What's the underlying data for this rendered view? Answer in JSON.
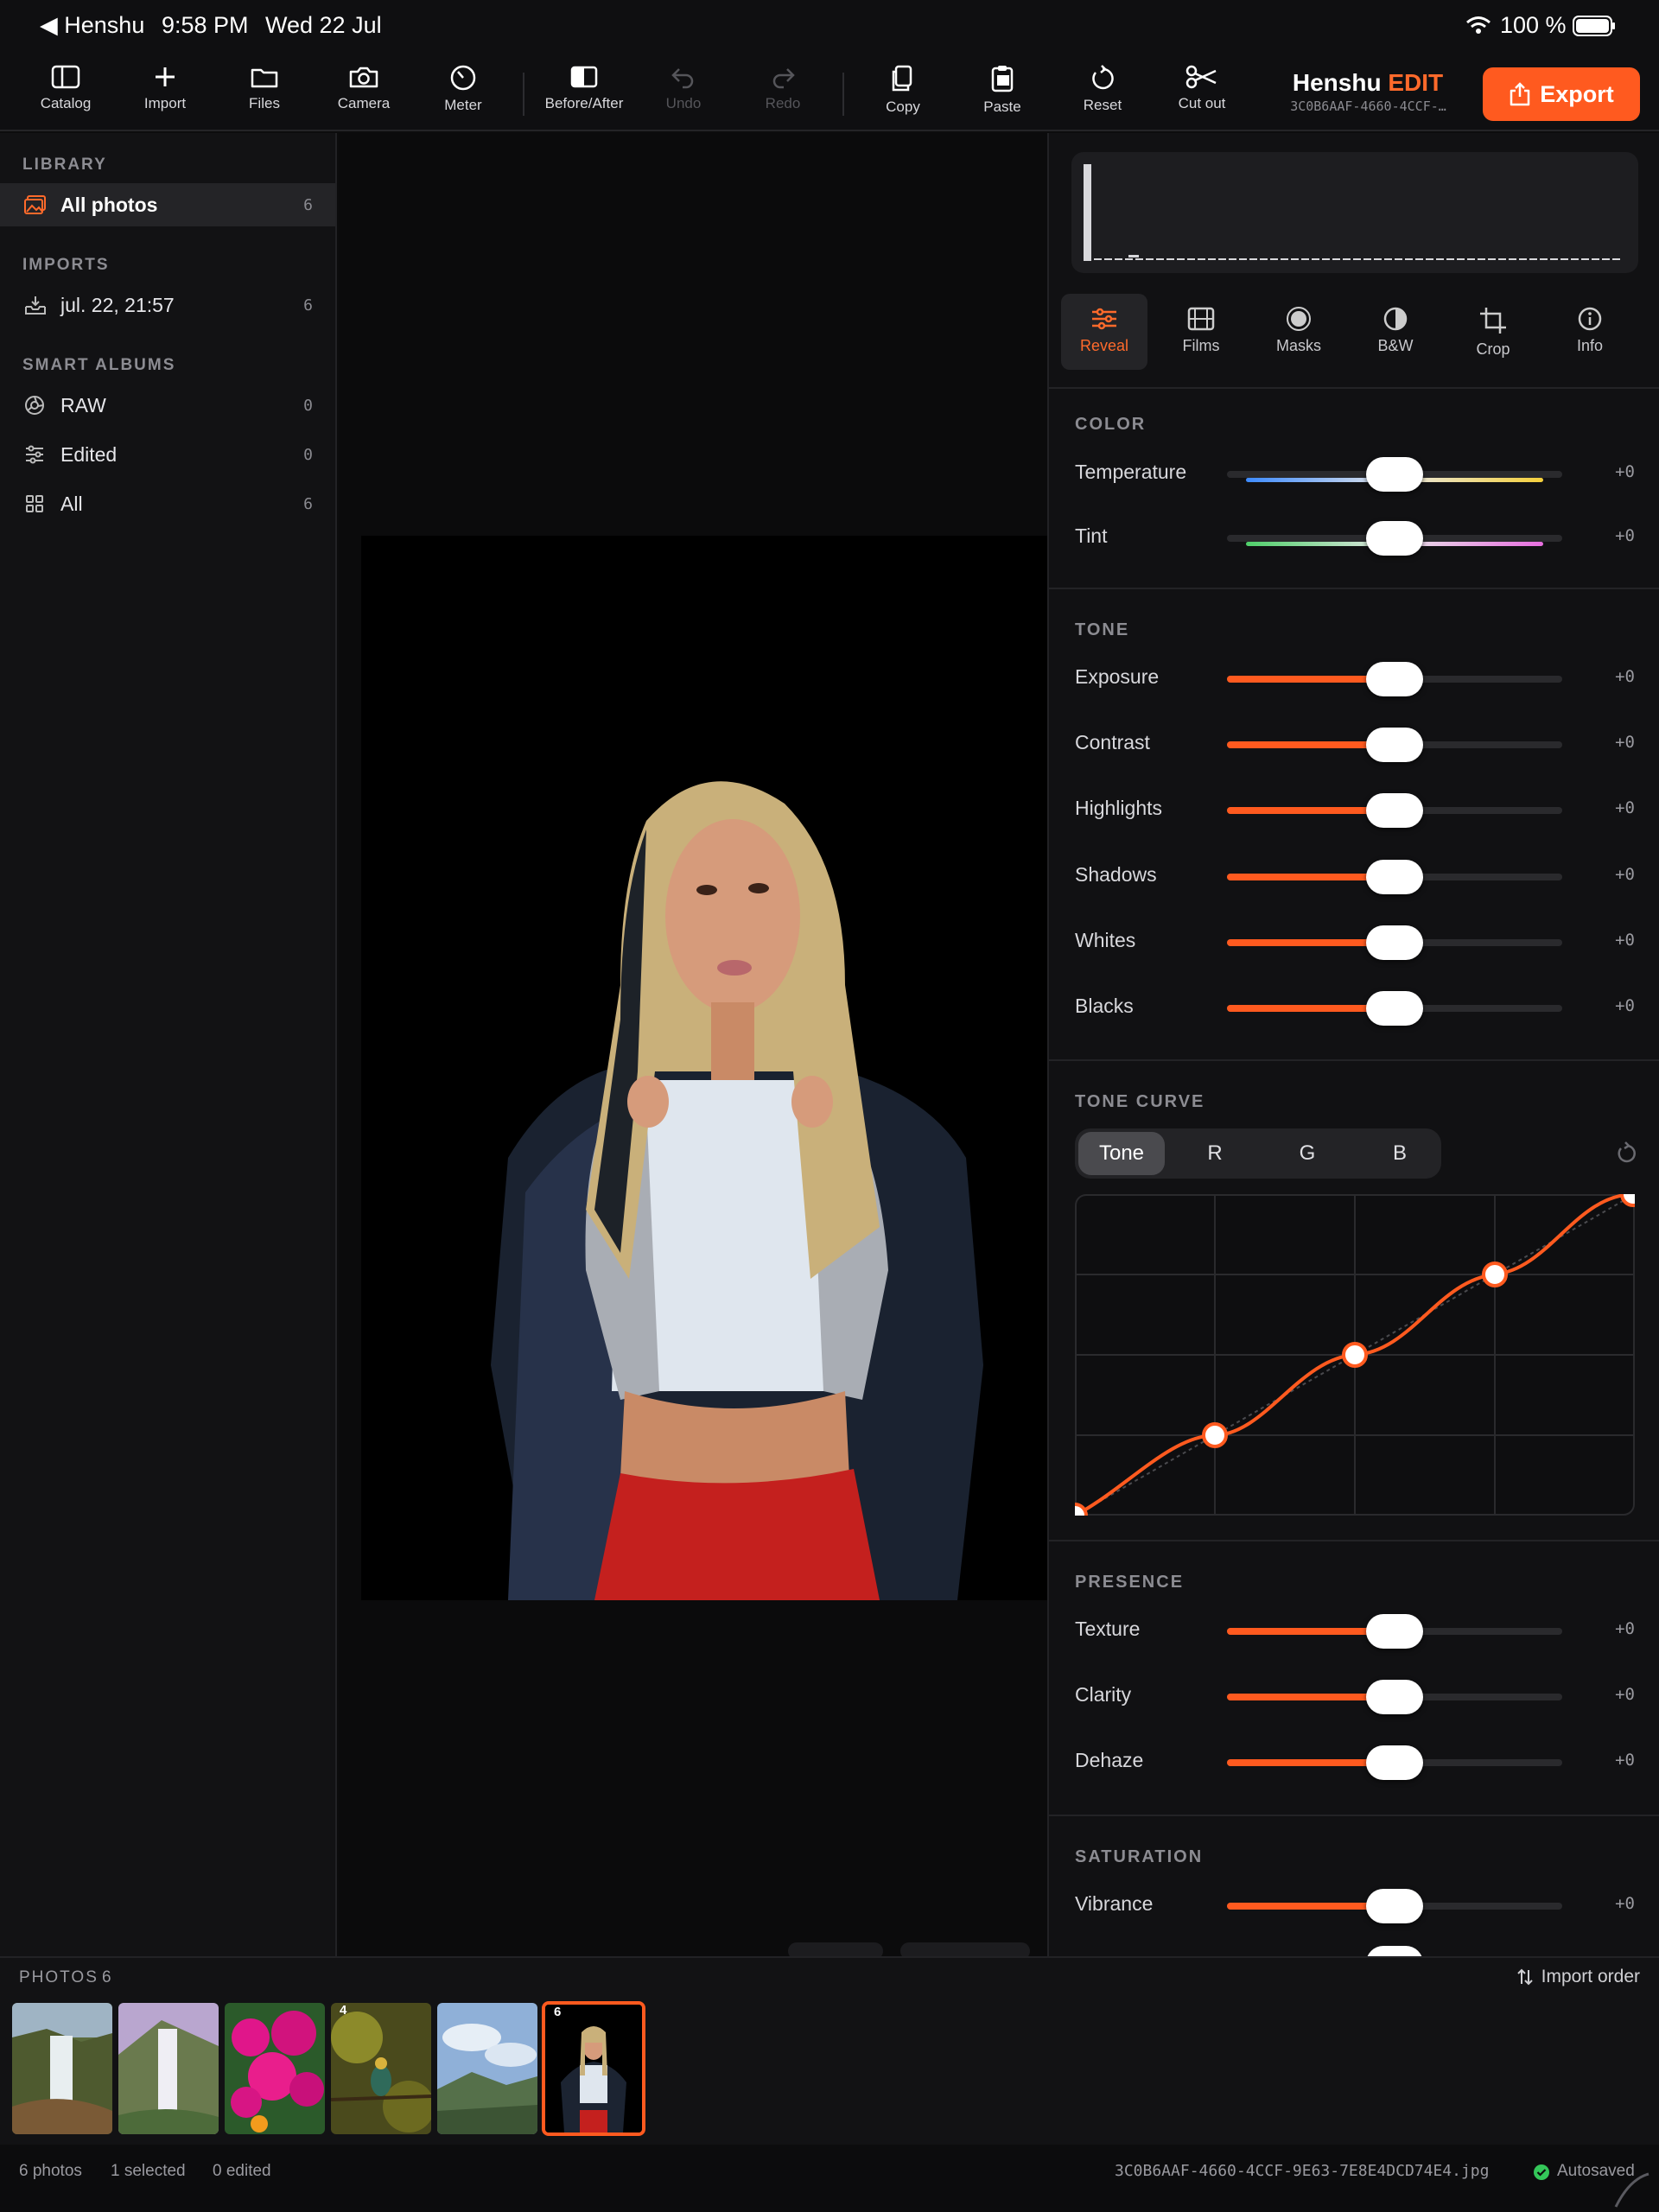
{
  "status": {
    "back_label": "Henshu",
    "time": "9:58 PM",
    "date": "Wed 22 Jul",
    "battery": "100 %"
  },
  "toolbar": {
    "catalog": "Catalog",
    "import": "Import",
    "files": "Files",
    "camera": "Camera",
    "meter": "Meter",
    "before_after": "Before/After",
    "undo": "Undo",
    "redo": "Redo",
    "copy": "Copy",
    "paste": "Paste",
    "reset": "Reset",
    "cut_out": "Cut out",
    "brand_name": "Henshu",
    "brand_edit": "EDIT",
    "file_id_short": "3C0B6AAF-4660-4CCF-…",
    "export": "Export"
  },
  "sidebar": {
    "library_header": "LIBRARY",
    "all_photos": {
      "label": "All photos",
      "count": "6"
    },
    "imports_header": "IMPORTS",
    "import_item": {
      "label": "jul. 22, 21:57",
      "count": "6"
    },
    "smart_header": "SMART ALBUMS",
    "raw": {
      "label": "RAW",
      "count": "0"
    },
    "edited": {
      "label": "Edited",
      "count": "0"
    },
    "all": {
      "label": "All",
      "count": "6"
    }
  },
  "tabs": {
    "reveal": "Reveal",
    "films": "Films",
    "masks": "Masks",
    "bw": "B&W",
    "crop": "Crop",
    "info": "Info"
  },
  "color": {
    "header": "COLOR",
    "temperature": {
      "label": "Temperature",
      "value": "+0"
    },
    "tint": {
      "label": "Tint",
      "value": "+0"
    }
  },
  "tone": {
    "header": "TONE",
    "exposure": {
      "label": "Exposure",
      "value": "+0"
    },
    "contrast": {
      "label": "Contrast",
      "value": "+0"
    },
    "highlights": {
      "label": "Highlights",
      "value": "+0"
    },
    "shadows": {
      "label": "Shadows",
      "value": "+0"
    },
    "whites": {
      "label": "Whites",
      "value": "+0"
    },
    "blacks": {
      "label": "Blacks",
      "value": "+0"
    }
  },
  "tone_curve": {
    "header": "TONE CURVE",
    "channels": [
      "Tone",
      "R",
      "G",
      "B"
    ],
    "active_channel": "Tone"
  },
  "presence": {
    "header": "PRESENCE",
    "texture": {
      "label": "Texture",
      "value": "+0"
    },
    "clarity": {
      "label": "Clarity",
      "value": "+0"
    },
    "dehaze": {
      "label": "Dehaze",
      "value": "+0"
    }
  },
  "saturation": {
    "header": "SATURATION",
    "vibrance": {
      "label": "Vibrance",
      "value": "+0"
    }
  },
  "filmstrip": {
    "title": "PHOTOS",
    "count": "6",
    "sort": "Import order",
    "badges": {
      "t4": "4",
      "t6": "6"
    }
  },
  "footer": {
    "photos": "6 photos",
    "selected": "1 selected",
    "edited": "0 edited",
    "filename": "3C0B6AAF-4660-4CCF-9E63-7E8E4DCD74E4.jpg",
    "autosaved": "Autosaved"
  },
  "colors": {
    "accent": "#ff5a1f",
    "panel": "#111113",
    "background": "#0c0c0d"
  }
}
